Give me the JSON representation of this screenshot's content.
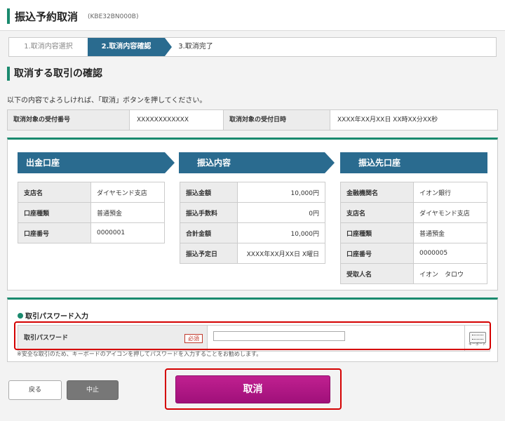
{
  "header": {
    "title": "振込予約取消",
    "code": "(KBE32BN000B)"
  },
  "steps": [
    "1.取消内容選択",
    "2.取消内容確認",
    "3.取消完了"
  ],
  "section_title": "取消する取引の確認",
  "lead": "以下の内容でよろしければ、「取消」ボタンを押してください。",
  "info": {
    "receipt_no_label": "取消対象の受付番号",
    "receipt_no_value": "XXXXXXXXXXXX",
    "receipt_dt_label": "取消対象の受付日時",
    "receipt_dt_value": "XXXX年XX月XX日 XX時XX分XX秒"
  },
  "columns": {
    "from": {
      "title": "出金口座",
      "rows": [
        {
          "k": "支店名",
          "v": "ダイヤモンド支店"
        },
        {
          "k": "口座種類",
          "v": "普通預金"
        },
        {
          "k": "口座番号",
          "v": "0000001"
        }
      ]
    },
    "detail": {
      "title": "振込内容",
      "rows": [
        {
          "k": "振込金額",
          "v": "10,000円"
        },
        {
          "k": "振込手数料",
          "v": "0円"
        },
        {
          "k": "合計金額",
          "v": "10,000円"
        },
        {
          "k": "振込予定日",
          "v": "XXXX年XX月XX日 X曜日"
        }
      ]
    },
    "to": {
      "title": "振込先口座",
      "rows": [
        {
          "k": "金融機関名",
          "v": "イオン銀行"
        },
        {
          "k": "支店名",
          "v": "ダイヤモンド支店"
        },
        {
          "k": "口座種類",
          "v": "普通預金"
        },
        {
          "k": "口座番号",
          "v": "0000005"
        },
        {
          "k": "受取人名",
          "v": "イオン　タロウ"
        }
      ]
    }
  },
  "password": {
    "section": "取引パスワード入力",
    "label": "取引パスワード",
    "required": "必須",
    "value": "",
    "keyboard_text": "キーボード",
    "note": "※安全な取引のため、キーボードのアイコンを押してパスワードを入力することをお勧めします。"
  },
  "buttons": {
    "back": "戻る",
    "stop": "中止",
    "cancel": "取消"
  },
  "colors": {
    "accent": "#1a8a6e",
    "column_head": "#2a6b8f",
    "cancel_button": "#b0187f",
    "highlight": "#d40000"
  }
}
